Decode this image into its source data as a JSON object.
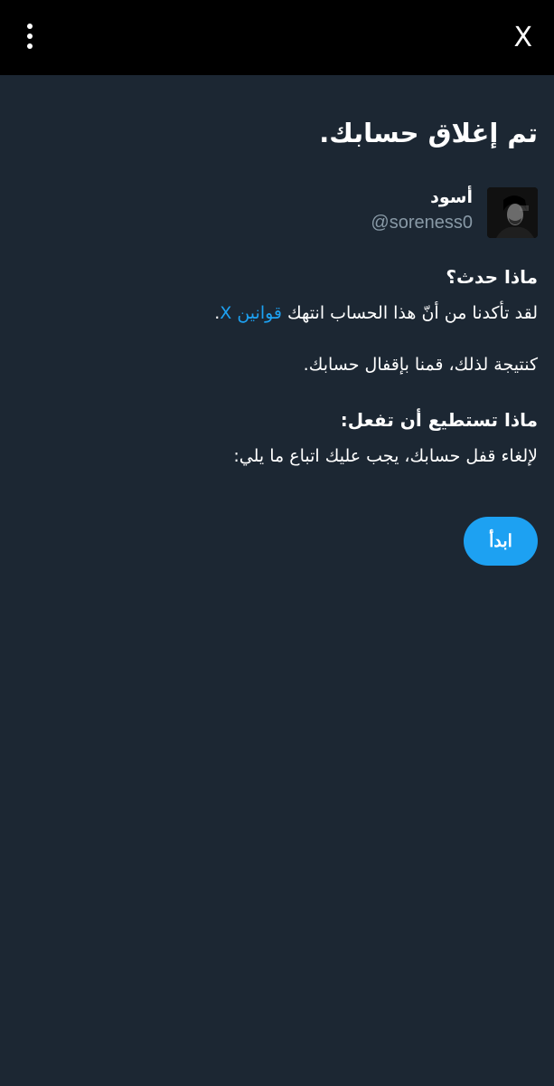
{
  "header": {
    "close_label": "X"
  },
  "main": {
    "title": "تم إغلاق حسابك.",
    "profile": {
      "display_name": "أسود",
      "handle": "@soreness0"
    },
    "what_happened": {
      "heading": "ماذا حدث؟",
      "text_before_link": "لقد تأكدنا من أنّ هذا الحساب انتهك ",
      "link_text": "قوانين X",
      "text_after_link": ".",
      "result_text": "كنتيجة لذلك، قمنا بإقفال حسابك."
    },
    "what_to_do": {
      "heading": "ماذا تستطيع أن تفعل:",
      "text": "لإلغاء قفل حسابك، يجب عليك اتباع ما يلي:"
    },
    "start_button_label": "ابدأ"
  },
  "colors": {
    "background": "#1c2733",
    "topbar": "#000000",
    "accent": "#1da1f2",
    "secondary_text": "#8899a6"
  },
  "icons": {
    "menu": "more-vertical-icon",
    "close": "close-icon"
  }
}
